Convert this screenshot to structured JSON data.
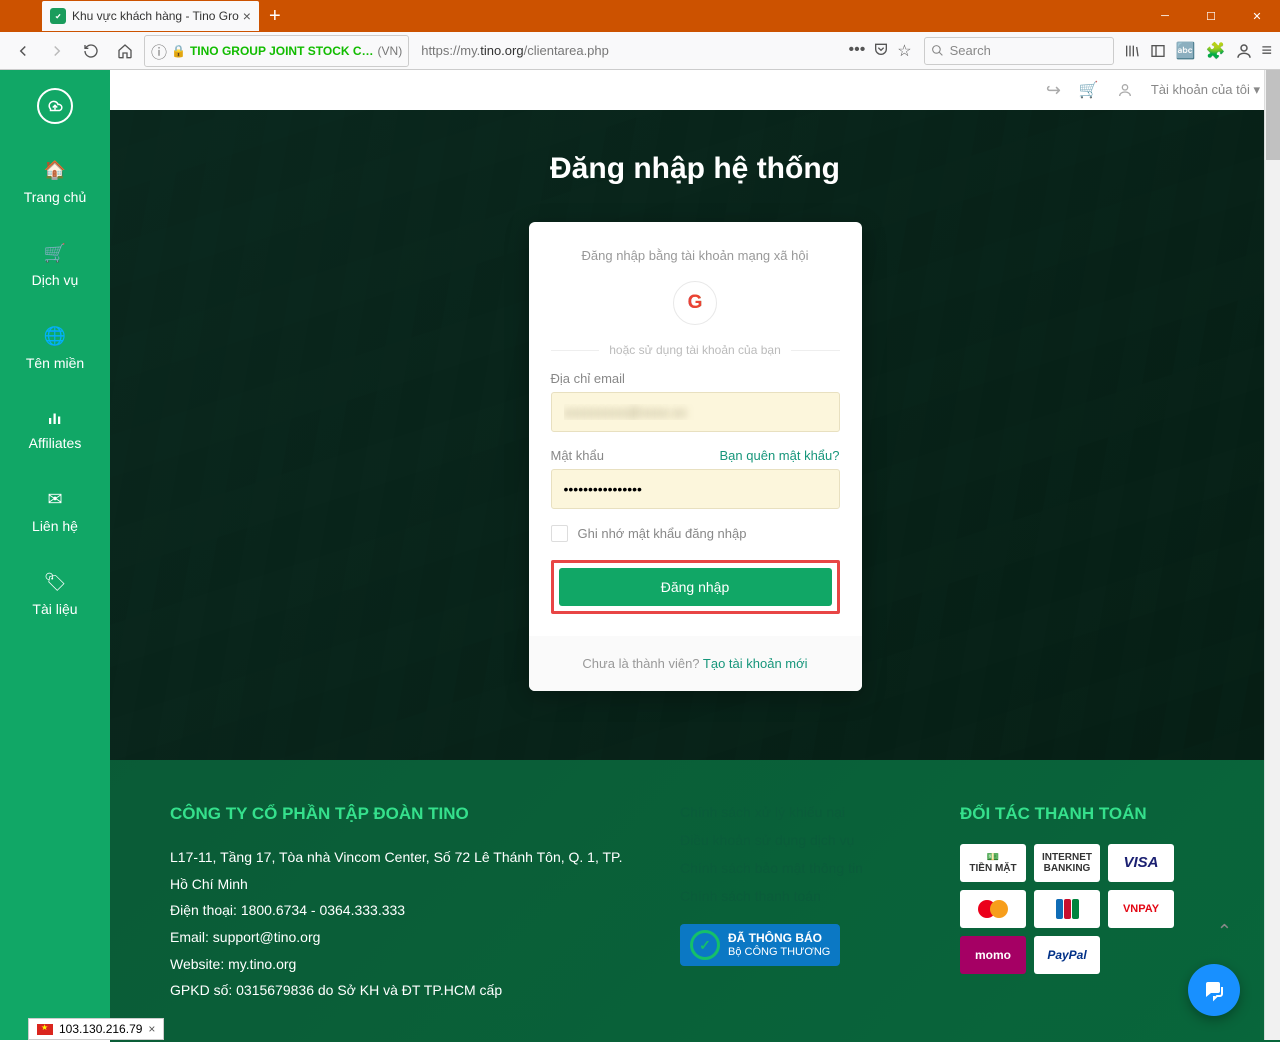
{
  "browser": {
    "tab_title": "Khu vực khách hàng - Tino Gro",
    "company_name": "TINO GROUP JOINT STOCK C…",
    "country_code": "(VN)",
    "url_prefix": "https://my.",
    "url_host": "tino.org",
    "url_path": "/clientarea.php",
    "search_placeholder": "Search"
  },
  "topbar": {
    "account_label": "Tài khoản của tôi"
  },
  "sidebar": {
    "items": [
      {
        "label": "Trang chủ"
      },
      {
        "label": "Dịch vụ"
      },
      {
        "label": "Tên miền"
      },
      {
        "label": "Affiliates"
      },
      {
        "label": "Liên hệ"
      },
      {
        "label": "Tài liệu"
      }
    ]
  },
  "hero": {
    "title": "Đăng nhập hệ thống",
    "social_title": "Đăng nhập bằng tài khoản mạng xã hội",
    "divider": "hoặc sử dụng tài khoản của bạn",
    "email_label": "Địa chỉ email",
    "email_value": "xxxxxxxxx@xxxx.xx",
    "password_label": "Mật khẩu",
    "forgot": "Bạn quên mật khẩu?",
    "password_value": "••••••••••••••••",
    "remember": "Ghi nhớ mật khẩu đăng nhập",
    "login_btn": "Đăng nhập",
    "footer_text": "Chưa là thành viên? ",
    "footer_link": "Tạo tài khoản mới"
  },
  "footer": {
    "company_title": "CÔNG TY CỔ PHẦN TẬP ĐOÀN TINO",
    "lines": [
      "L17-11, Tầng 17, Tòa nhà Vincom Center, Số 72 Lê Thánh Tôn, Q. 1, TP. Hồ Chí Minh",
      "Điện thoại: 1800.6734 - 0364.333.333",
      "Email: support@tino.org",
      "Website: my.tino.org",
      "GPKD số: 0315679836 do Sở KH và ĐT TP.HCM cấp"
    ],
    "links": [
      "Chính sách xử lý khiếu nại",
      "Điều khoản sử dụng dịch vụ",
      "Chính sách bảo mật thông tin",
      "Chính sách thanh toán"
    ],
    "gov_line1": "ĐÃ THÔNG BÁO",
    "gov_line2": "Bộ CÔNG THƯƠNG",
    "partners_title": "ĐỐI TÁC THANH TOÁN",
    "pay": {
      "cash": "TIỀN MẶT",
      "ib": "INTERNET BANKING",
      "visa": "VISA",
      "vnpay": "VNPAY",
      "momo": "momo",
      "paypal": "PayPal"
    }
  },
  "ip_toast": "103.130.216.79"
}
